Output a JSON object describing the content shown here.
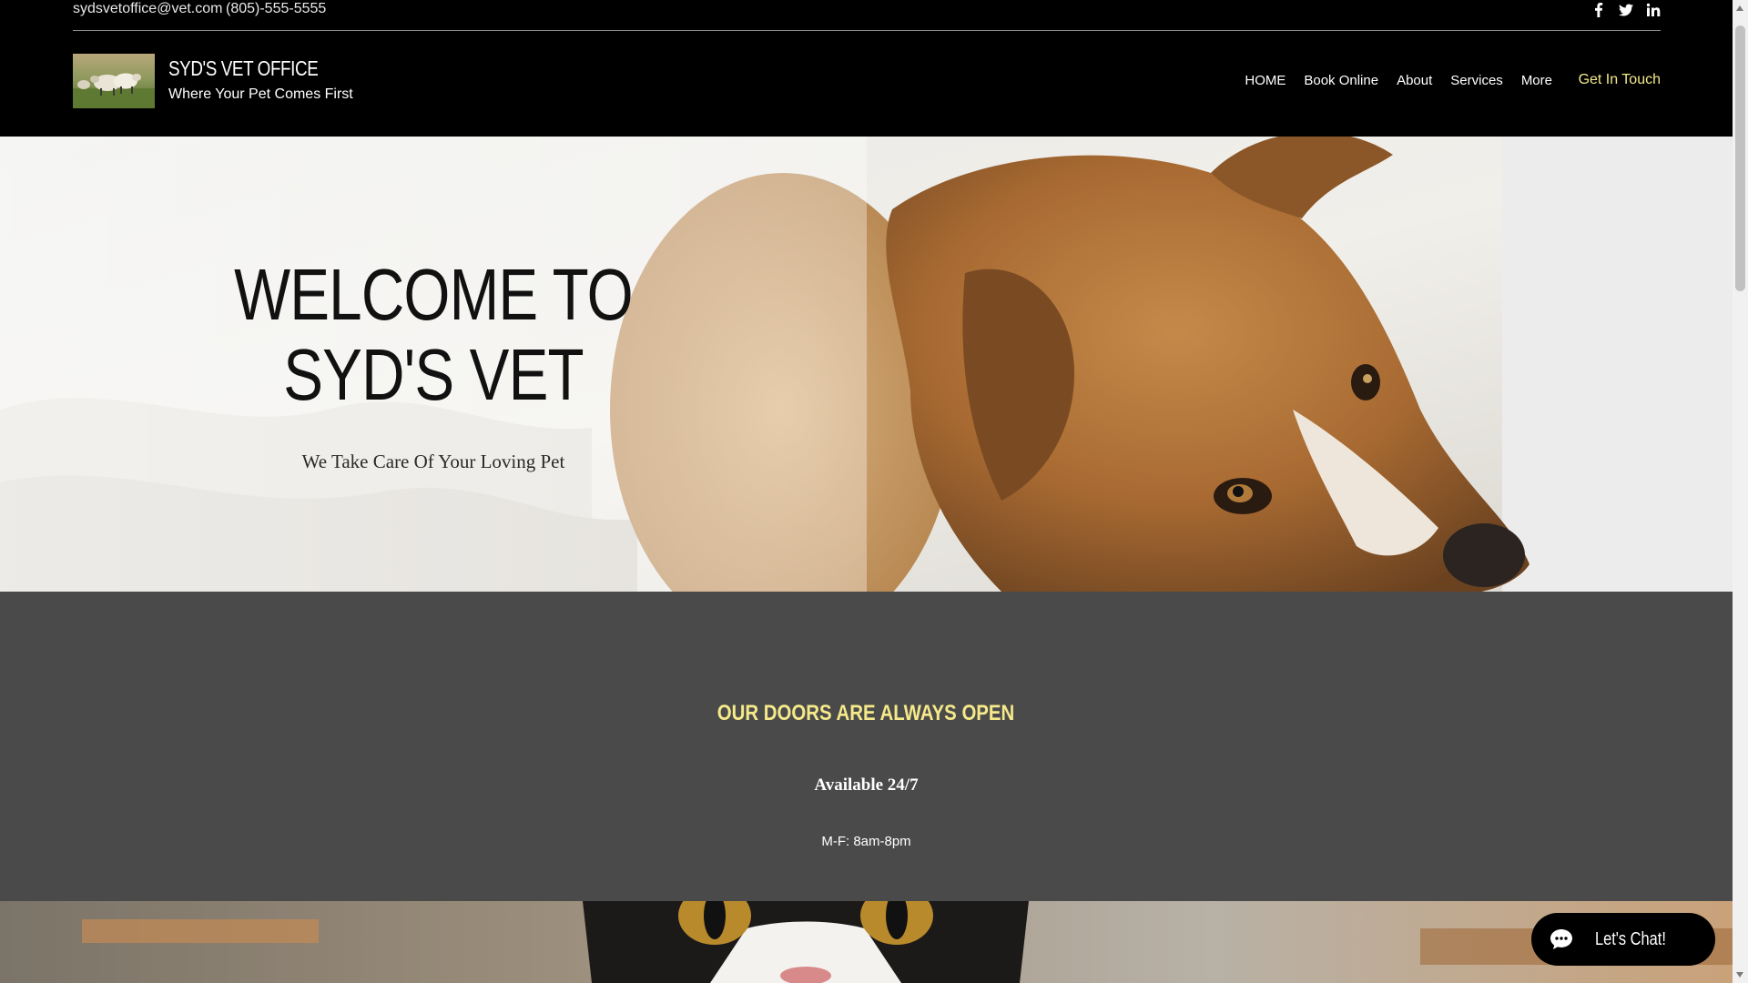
{
  "topbar": {
    "email": "sydsvetoffice@vet.com",
    "phone": "(805)-555-5555",
    "social": [
      "facebook-icon",
      "twitter-icon",
      "linkedin-icon"
    ]
  },
  "brand": {
    "name": "SYD'S VET OFFICE",
    "tagline": "Where Your Pet Comes First"
  },
  "nav": {
    "items": [
      "HOME",
      "Book Online",
      "About",
      "Services",
      "More"
    ],
    "cta": "Get In Touch"
  },
  "hero": {
    "title_line1": "WELCOME TO",
    "title_line2": "SYD'S VET",
    "subtitle": "We Take Care Of Your Loving Pet"
  },
  "hours": {
    "heading": "OUR DOORS ARE ALWAYS OPEN",
    "availability": "Available 24/7",
    "schedule": "M-F: 8am-8pm"
  },
  "chat": {
    "label": "Let's Chat!"
  },
  "colors": {
    "accent": "#f5e98a",
    "band": "#4a4a4a",
    "header": "#000000"
  }
}
